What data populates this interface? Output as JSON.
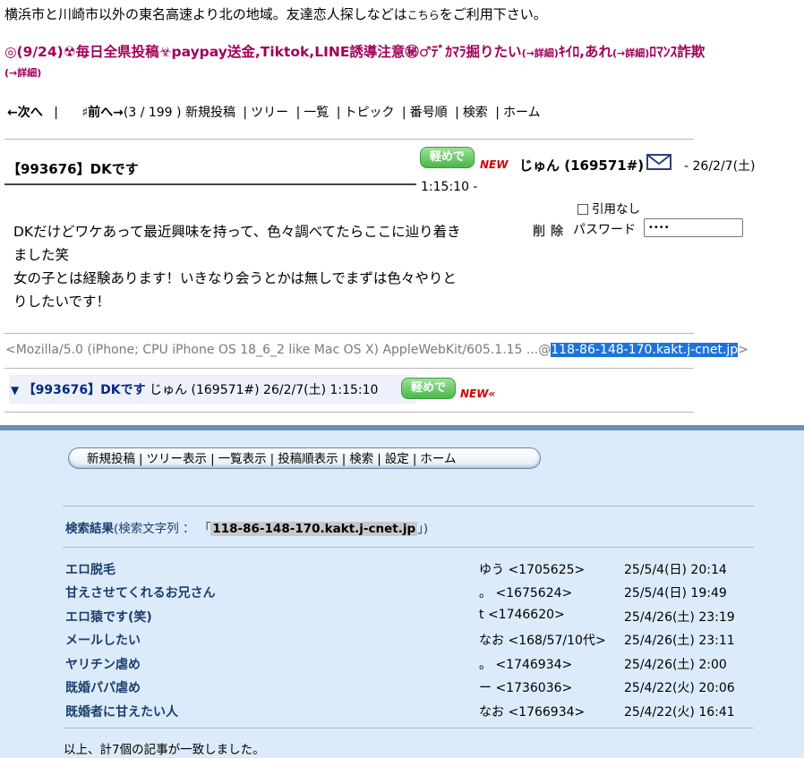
{
  "intro": {
    "text": "横浜市と川崎市以外の東名高速より北の地域。友達恋人探しなどは",
    "link": "こちら",
    "tail": "をご利用下さい。"
  },
  "notice": {
    "line1_a": "◎(9/24)☢毎日全県投稿☣paypay送金,Tiktok,LINE誘導注意㊙♂ﾃﾞｶﾏﾗ掘りたい",
    "detail": "(→詳細)",
    "line1_b": "ｷｲﾛ,あれ",
    "line1_c": "ﾛﾏﾝｽ詐欺",
    "line2": "(→詳細)"
  },
  "topnav": {
    "next": "←次へ",
    "bar": "|",
    "prev": "♯前へ→",
    "position": "(3 / 199 )",
    "items": [
      "新規投稿",
      "ツリー",
      "一覧",
      "トピック",
      "番号順",
      "検索",
      "ホーム"
    ]
  },
  "post": {
    "title": "【993676】DKです",
    "badge": "軽めで",
    "new": "NEW",
    "author": "じゅん (169571#)",
    "date": "- 26/2/7(土)",
    "time": "1:15:10 -",
    "quote_opt": "引用なし",
    "delete": "削除",
    "password_label": "パスワード",
    "password_value": "••••",
    "body_lines": [
      "DKだけどワケあって最近興味を持って、色々調べてたらここに辿り着き",
      "ました笑",
      "女の子とは経験あります！いきなり会うとかは無しでまずは色々やりと",
      "りしたいです！"
    ],
    "ua_prefix": "<Mozilla/5.0 (iPhone; CPU iPhone OS 18_6_2 like Mac OS X) AppleWebKit/605.1.15 ...@",
    "ua_host": "118-86-148-170.kakt.j-cnet.jp",
    "ua_suffix": ">"
  },
  "thread": {
    "tri": "▼",
    "title": "【993676】DKです",
    "meta": " じゅん (169571#) 26/2/7(土) 1:15:10",
    "badge": "軽めで",
    "new": "NEW«"
  },
  "bottom_nav": [
    "新規投稿",
    "ツリー表示",
    "一覧表示",
    "投稿順表示",
    "検索",
    "設定",
    "ホーム"
  ],
  "search": {
    "label": "検索結果",
    "open": "(検索文字列 ： 「",
    "query": "118-86-148-170.kakt.j-cnet.jp",
    "close": "」)",
    "results": [
      {
        "title": "エロ脱毛",
        "author": "ゆう <1705625>",
        "date": "25/5/4(日) 20:14"
      },
      {
        "title": "甘えさせてくれるお兄さん",
        "author": "。 <1675624>",
        "date": "25/5/4(日) 19:49"
      },
      {
        "title": "エロ猿です(笑)",
        "author": "t <1746620>",
        "date": "25/4/26(土) 23:19"
      },
      {
        "title": "メールしたい",
        "author": "なお <168/57/10代>",
        "date": "25/4/26(土) 23:11"
      },
      {
        "title": "ヤリチン虐め",
        "author": "。 <1746934>",
        "date": "25/4/26(土) 2:00"
      },
      {
        "title": "既婚パパ虐め",
        "author": "ー <1736036>",
        "date": "25/4/22(火) 20:06"
      },
      {
        "title": "既婚者に甘えたい人",
        "author": "なお <1766934>",
        "date": "25/4/22(火) 16:41"
      }
    ],
    "footer": "以上、計7個の記事が一致しました。"
  }
}
